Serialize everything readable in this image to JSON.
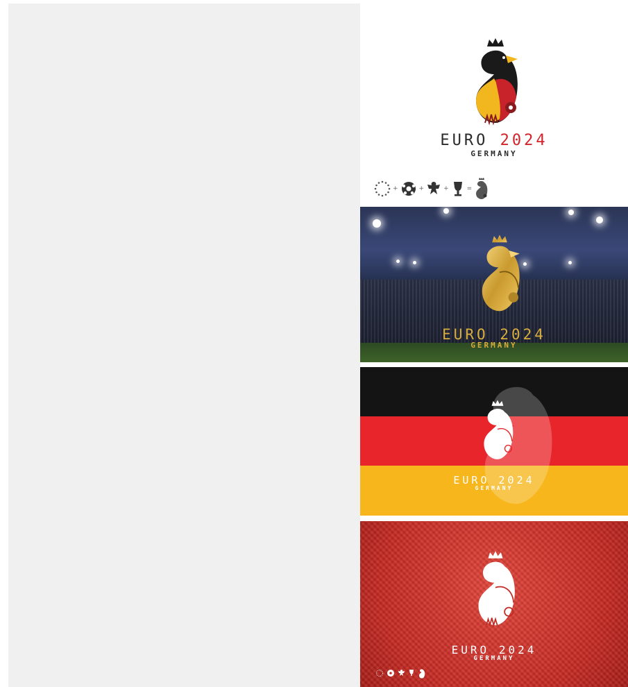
{
  "logo": {
    "euro_word": "EURO",
    "year": "2024",
    "country": "GERMANY"
  },
  "equation": {
    "items": [
      "stars-ring-icon",
      "football-icon",
      "eagle-crest-icon",
      "trophy-icon",
      "eagle-logo-icon"
    ],
    "plus": "+",
    "equals": "="
  },
  "colors": {
    "brand_red": "#d2232a",
    "flag_black": "#141414",
    "flag_red": "#e8252a",
    "flag_gold": "#f7b61b",
    "gold_text": "#d9ad3d",
    "dark_text": "#2a2a2a"
  }
}
